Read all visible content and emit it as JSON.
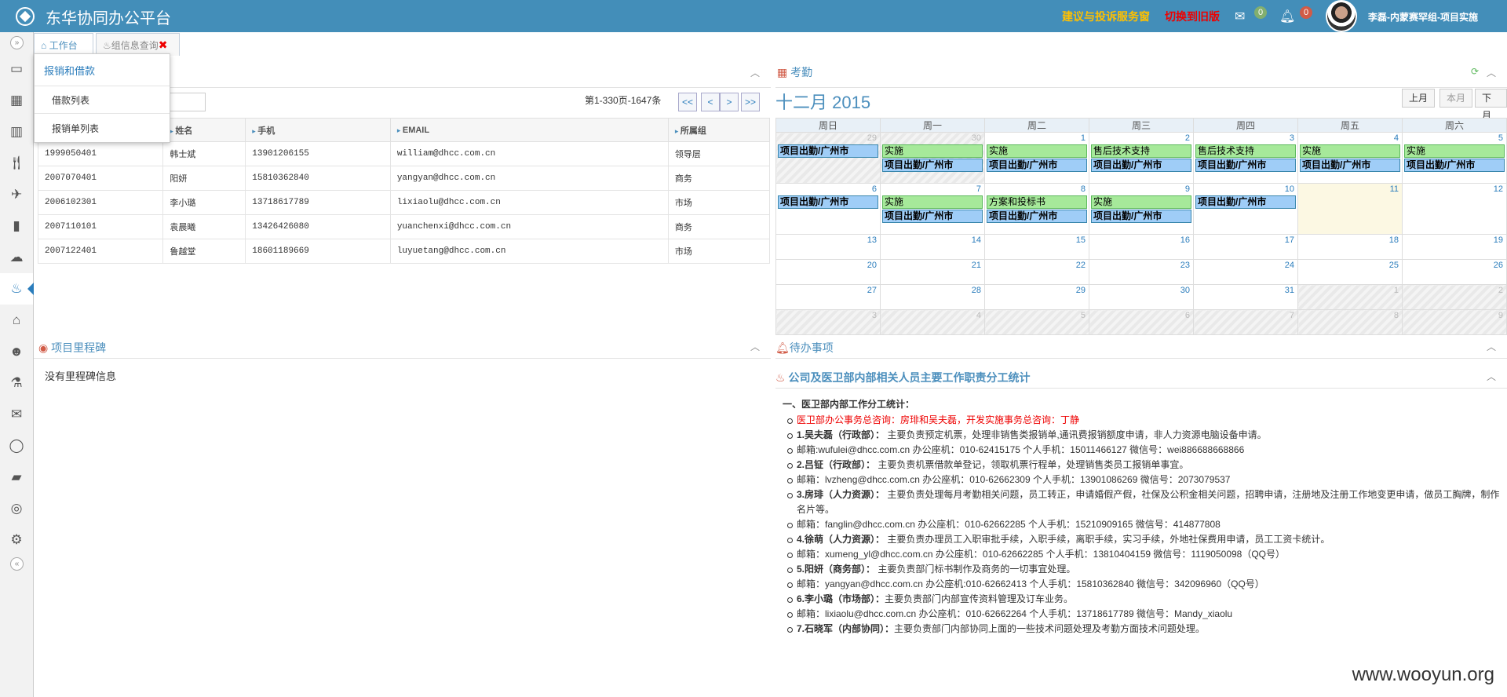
{
  "header": {
    "title": "东华协同办公平台",
    "suggest": "建议与投诉服务窗",
    "switch": "切换到旧版",
    "mail_count": "0",
    "bell_count": "0",
    "user": "李磊-内蒙赛罕组-项目实施"
  },
  "tabs": [
    {
      "label": "工作台"
    },
    {
      "label": "组信息查询"
    }
  ],
  "dropdown": {
    "header": "报销和借款",
    "items": [
      "借款列表",
      "报销单列表"
    ]
  },
  "contacts": {
    "pager": "第1-330页-1647条",
    "buttons": [
      "<<",
      "<",
      ">",
      ">>"
    ],
    "columns": [
      "",
      "姓名",
      "手机",
      "EMAIL",
      "所属组"
    ],
    "rows": [
      [
        "1999050401",
        "韩士斌",
        "13901206155",
        "william@dhcc.com.cn",
        "领导层"
      ],
      [
        "2007070401",
        "阳妍",
        "15810362840",
        "yangyan@dhcc.com.cn",
        "商务"
      ],
      [
        "2006102301",
        "李小璐",
        "13718617789",
        "lixiaolu@dhcc.com.cn",
        "市场"
      ],
      [
        "2007110101",
        "袁晨曦",
        "13426426080",
        "yuanchenxi@dhcc.com.cn",
        "商务"
      ],
      [
        "2007122401",
        "鲁越堂",
        "18601189669",
        "luyuetang@dhcc.com.cn",
        "市场"
      ]
    ]
  },
  "attendance": {
    "title": "考勤",
    "month": "十二月 2015",
    "buttons": [
      "上月",
      "本月",
      "下月"
    ],
    "weekdays": [
      "周日",
      "周一",
      "周二",
      "周三",
      "周四",
      "周五",
      "周六"
    ],
    "weeks": [
      [
        {
          "d": "29",
          "o": 1,
          "e": [
            [
              "项目出勤/广州市",
              "b"
            ]
          ]
        },
        {
          "d": "30",
          "o": 1,
          "e": [
            [
              "实施",
              "g"
            ],
            [
              "项目出勤/广州市",
              "b"
            ]
          ]
        },
        {
          "d": "1",
          "e": [
            [
              "实施",
              "g"
            ],
            [
              "项目出勤/广州市",
              "b"
            ]
          ]
        },
        {
          "d": "2",
          "e": [
            [
              "售后技术支持",
              "g"
            ],
            [
              "项目出勤/广州市",
              "b"
            ]
          ]
        },
        {
          "d": "3",
          "e": [
            [
              "售后技术支持",
              "g"
            ],
            [
              "项目出勤/广州市",
              "b"
            ]
          ]
        },
        {
          "d": "4",
          "e": [
            [
              "实施",
              "g"
            ],
            [
              "项目出勤/广州市",
              "b"
            ]
          ]
        },
        {
          "d": "5",
          "e": [
            [
              "实施",
              "g"
            ],
            [
              "项目出勤/广州市",
              "b"
            ]
          ]
        }
      ],
      [
        {
          "d": "6",
          "e": [
            [
              "项目出勤/广州市",
              "b"
            ]
          ]
        },
        {
          "d": "7",
          "e": [
            [
              "实施",
              "g"
            ],
            [
              "项目出勤/广州市",
              "b"
            ]
          ]
        },
        {
          "d": "8",
          "e": [
            [
              "方案和投标书",
              "g"
            ],
            [
              "项目出勤/广州市",
              "b"
            ]
          ]
        },
        {
          "d": "9",
          "e": [
            [
              "实施",
              "g"
            ],
            [
              "项目出勤/广州市",
              "b"
            ]
          ]
        },
        {
          "d": "10",
          "e": [
            [
              "项目出勤/广州市",
              "b"
            ]
          ]
        },
        {
          "d": "11",
          "t": 1
        },
        {
          "d": "12"
        }
      ],
      [
        {
          "d": "13"
        },
        {
          "d": "14"
        },
        {
          "d": "15"
        },
        {
          "d": "16"
        },
        {
          "d": "17"
        },
        {
          "d": "18"
        },
        {
          "d": "19"
        }
      ],
      [
        {
          "d": "20"
        },
        {
          "d": "21"
        },
        {
          "d": "22"
        },
        {
          "d": "23"
        },
        {
          "d": "24"
        },
        {
          "d": "25"
        },
        {
          "d": "26"
        }
      ],
      [
        {
          "d": "27"
        },
        {
          "d": "28"
        },
        {
          "d": "29"
        },
        {
          "d": "30"
        },
        {
          "d": "31"
        },
        {
          "d": "1",
          "o": 1
        },
        {
          "d": "2",
          "o": 1
        }
      ],
      [
        {
          "d": "3",
          "o": 1
        },
        {
          "d": "4",
          "o": 1
        },
        {
          "d": "5",
          "o": 1
        },
        {
          "d": "6",
          "o": 1
        },
        {
          "d": "7",
          "o": 1
        },
        {
          "d": "8",
          "o": 1
        },
        {
          "d": "9",
          "o": 1
        }
      ]
    ]
  },
  "milestone": {
    "title": "项目里程碑",
    "empty": "没有里程碑信息"
  },
  "todo": {
    "title": "待办事项"
  },
  "duty": {
    "title": "公司及医卫部内部相关人员主要工作职责分工统计",
    "heading": "一、医卫部内部工作分工统计：",
    "lines": [
      {
        "r": "医卫部办公事务总咨询：房琲和吴夫磊，开发实施事务总咨询：丁静"
      },
      {
        "b": "1.吴夫磊（行政部）：",
        "t": " 主要负责预定机票，处理非销售类报销单,通讯费报销额度申请，非人力资源电脑设备申请。"
      },
      {
        "t": "邮箱:wufulei@dhcc.com.cn 办公座机：010-62415175 个人手机：15011466127 微信号：wei886688668866"
      },
      {
        "b": "2.吕钲（行政部）：",
        "t": " 主要负责机票借款单登记，领取机票行程单，处理销售类员工报销单事宜。"
      },
      {
        "t": "邮箱：lvzheng@dhcc.com.cn 办公座机：010-62662309 个人手机：13901086269 微信号：2073079537"
      },
      {
        "b": "3.房琲（人力资源）：",
        "t": " 主要负责处理每月考勤相关问题，员工转正，申请婚假产假，社保及公积金相关问题，招聘申请，注册地及注册工作地变更申请，做员工胸牌，制作名片等。"
      },
      {
        "t": "邮箱：fanglin@dhcc.com.cn 办公座机：010-62662285 个人手机：15210909165 微信号：414877808"
      },
      {
        "b": "4.徐萌（人力资源）：",
        "t": " 主要负责办理员工入职审批手续，入职手续，离职手续，实习手续，外地社保费用申请，员工工资卡统计。"
      },
      {
        "t": "邮箱：xumeng_yl@dhcc.com.cn 办公座机：010-62662285 个人手机：13810404159 微信号：1119050098（QQ号）"
      },
      {
        "b": "5.阳妍（商务部）：",
        "t": " 主要负责部门标书制作及商务的一切事宜处理。"
      },
      {
        "t": "邮箱：yangyan@dhcc.com.cn 办公座机:010-62662413 个人手机：15810362840 微信号：342096960（QQ号）"
      },
      {
        "b": "6.李小璐（市场部）：",
        "t": "主要负责部门内部宣传资料管理及订车业务。"
      },
      {
        "t": "邮箱：lixiaolu@dhcc.com.cn 办公座机：010-62662264 个人手机：13718617789 微信号：Mandy_xiaolu"
      },
      {
        "b": "7.石晓军（内部协同）：",
        "t": "主要负责部门内部协同上面的一些技术问题处理及考勤方面技术问题处理。"
      }
    ]
  },
  "watermark": "www.wooyun.org",
  "sidebar_icons": [
    "book-icon",
    "calendar-icon",
    "bar-chart-icon",
    "food-icon",
    "plane-icon",
    "barcode-icon",
    "cloud-upload-icon",
    "fire-icon",
    "home-icon",
    "group-icon",
    "flask-icon",
    "envelope-icon",
    "comment-icon",
    "folder-open-icon",
    "comments-icon",
    "cog-icon"
  ],
  "colors": {
    "topbar": "#438eb9",
    "accent": "#2b7dbc",
    "event_green": "#a6e99a",
    "event_blue": "#9fcdf7"
  }
}
